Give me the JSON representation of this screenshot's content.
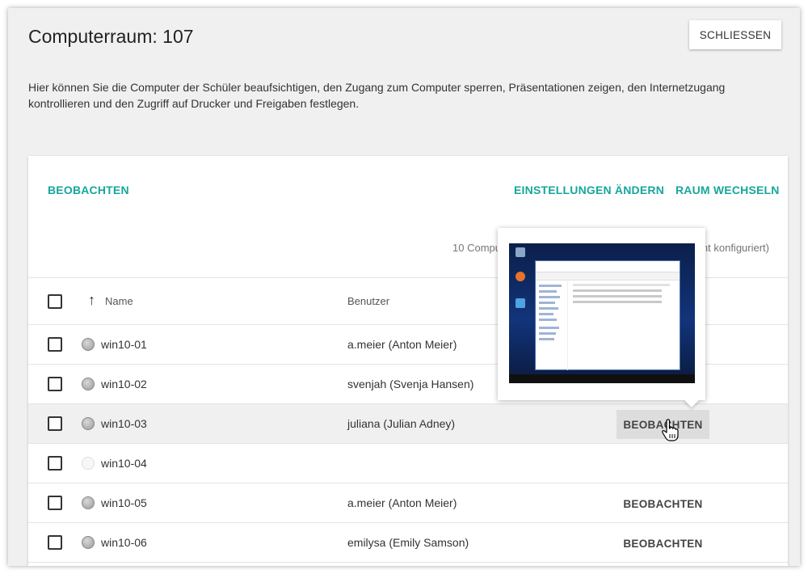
{
  "page": {
    "title": "Computerraum: 107",
    "close_label": "SCHLIESSEN",
    "description": "Hier können Sie die Computer der Schüler beaufsichtigen, den Zugang zum Computer sperren, Präsentationen zeigen, den Internetzugang kontrollieren und den Zugriff auf Drucker und Freigaben festlegen."
  },
  "card": {
    "actions": {
      "observe": "BEOBACHTEN",
      "change_settings": "EINSTELLUNGEN ÄNDERN",
      "switch_room": "RAUM WECHSELN"
    },
    "count_prefix": "10 Compu",
    "count_suffix": "nt konfiguriert)"
  },
  "table": {
    "columns": {
      "name": "Name",
      "user": "Benutzer"
    },
    "sort_icon": "arrow-up-icon",
    "rows": [
      {
        "name": "win10-01",
        "user": "a.meier (Anton Meier)",
        "action": "",
        "online": true
      },
      {
        "name": "win10-02",
        "user": "svenjah (Svenja Hansen)",
        "action": "",
        "online": true
      },
      {
        "name": "win10-03",
        "user": "juliana (Julian Adney)",
        "action": "BEOBACHTEN",
        "online": true
      },
      {
        "name": "win10-04",
        "user": "",
        "action": "",
        "online": false
      },
      {
        "name": "win10-05",
        "user": "a.meier (Anton Meier)",
        "action": "BEOBACHTEN",
        "online": true
      },
      {
        "name": "win10-06",
        "user": "emilysa (Emily Samson)",
        "action": "BEOBACHTEN",
        "online": true
      }
    ]
  },
  "colors": {
    "accent": "#16a79a",
    "hover_row": "#f0f0f0",
    "hover_button": "#dddddd"
  }
}
